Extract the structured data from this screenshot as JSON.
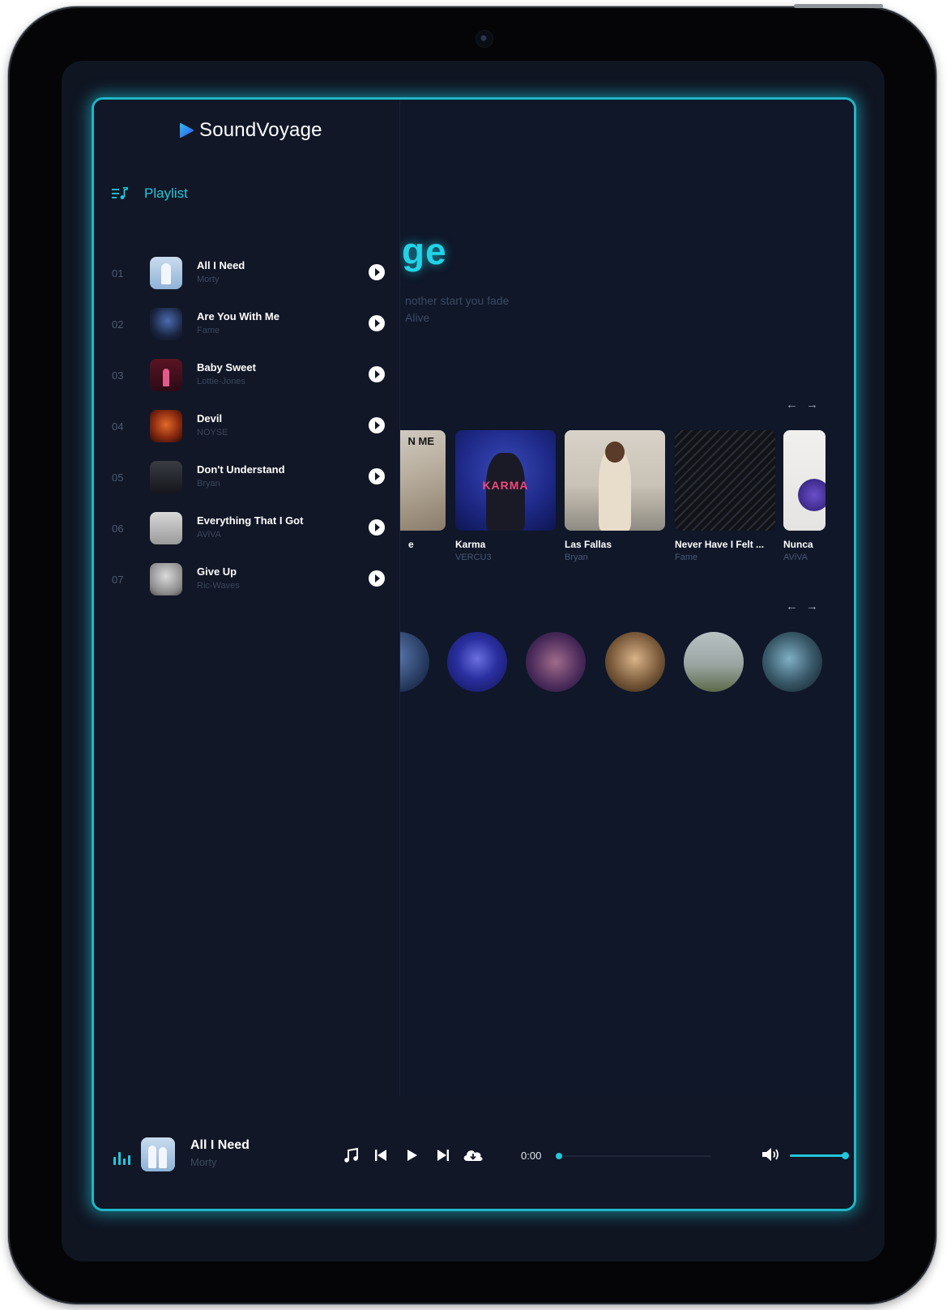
{
  "app": {
    "name": "SoundVoyage"
  },
  "sidebar": {
    "section_label": "Playlist",
    "tracks": [
      {
        "num": "01",
        "title": "All I Need",
        "artist": "Morty"
      },
      {
        "num": "02",
        "title": "Are You With Me",
        "artist": "Fame"
      },
      {
        "num": "03",
        "title": "Baby Sweet",
        "artist": "Lottie-Jones"
      },
      {
        "num": "04",
        "title": "Devil",
        "artist": "NOYSE"
      },
      {
        "num": "05",
        "title": "Don't Understand",
        "artist": "Bryan"
      },
      {
        "num": "06",
        "title": "Everything That I Got",
        "artist": "AViVA"
      },
      {
        "num": "07",
        "title": "Give Up",
        "artist": "Ric-Waves"
      }
    ]
  },
  "main": {
    "hero_title_fragment": "ge",
    "hero_sub_line1": "nother start you fade",
    "hero_sub_line2": "Alive",
    "albums": [
      {
        "title": "e",
        "artist": "",
        "cover_text": "N ME"
      },
      {
        "title": "Karma",
        "artist": "VERCU3",
        "cover_text": "KARMA"
      },
      {
        "title": "Las Fallas",
        "artist": "Bryan"
      },
      {
        "title": "Never Have I Felt ...",
        "artist": "Fame"
      },
      {
        "title": "Nunca",
        "artist": "AViVA"
      }
    ],
    "nav_prev_icon": "arrow-left-icon",
    "nav_next_icon": "arrow-right-icon"
  },
  "player": {
    "title": "All I Need",
    "artist": "Morty",
    "time": "0:00",
    "progress": 0,
    "volume": 1.0
  },
  "colors": {
    "accent": "#22c8dc",
    "background": "#0f1729",
    "sidebar": "#111726"
  }
}
